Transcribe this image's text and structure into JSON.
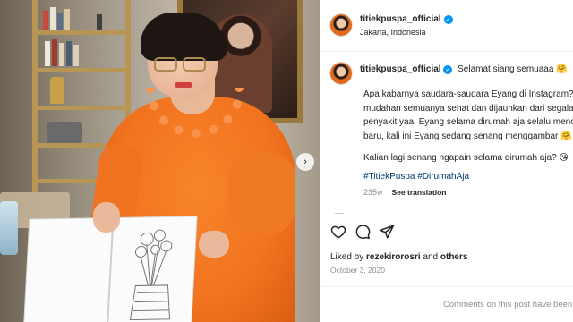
{
  "post": {
    "username": "titiekpuspa_official",
    "location": "Jakarta, Indonesia",
    "verified_mark": "✓"
  },
  "caption": {
    "username": "titiekpuspa_official",
    "greeting": "Selamat siang semuaaa",
    "greeting_emoji": "🤗",
    "paragraph1_line1": "Apa kabarnya saudara-saudara Eyang di Instagram?",
    "paragraph1_line2": "mudahan semuanya sehat dan dijauhkan dari segala",
    "paragraph1_line3": "penyakit yaa! Eyang selama dirumah aja selalu mencari",
    "paragraph1_line4": "baru, kali ini Eyang sedang senang menggambar",
    "paragraph1_emoji": "🤗",
    "paragraph2": "Kalian lagi senang ngapain selama dirumah aja?",
    "paragraph2_emoji": "😘",
    "hashtags": "#TitiekPuspa #DirumahAja",
    "age": "235w",
    "see_translation": "See translation"
  },
  "icons": {
    "like": "heart-icon",
    "comment": "comment-icon",
    "share": "send-icon",
    "next": "chevron-right-icon"
  },
  "likes": {
    "prefix": "Liked by",
    "user": "rezekirorosri",
    "conj": "and",
    "others": "others"
  },
  "date": "October 3, 2020",
  "footer": {
    "limited": "Comments on this post have been limited."
  },
  "carousel": {
    "next_glyph": "›"
  },
  "colors": {
    "accent_blue": "#0095f6",
    "hashtag": "#00376b",
    "muted": "#8e8e8e",
    "dress_orange": "#f27420"
  }
}
